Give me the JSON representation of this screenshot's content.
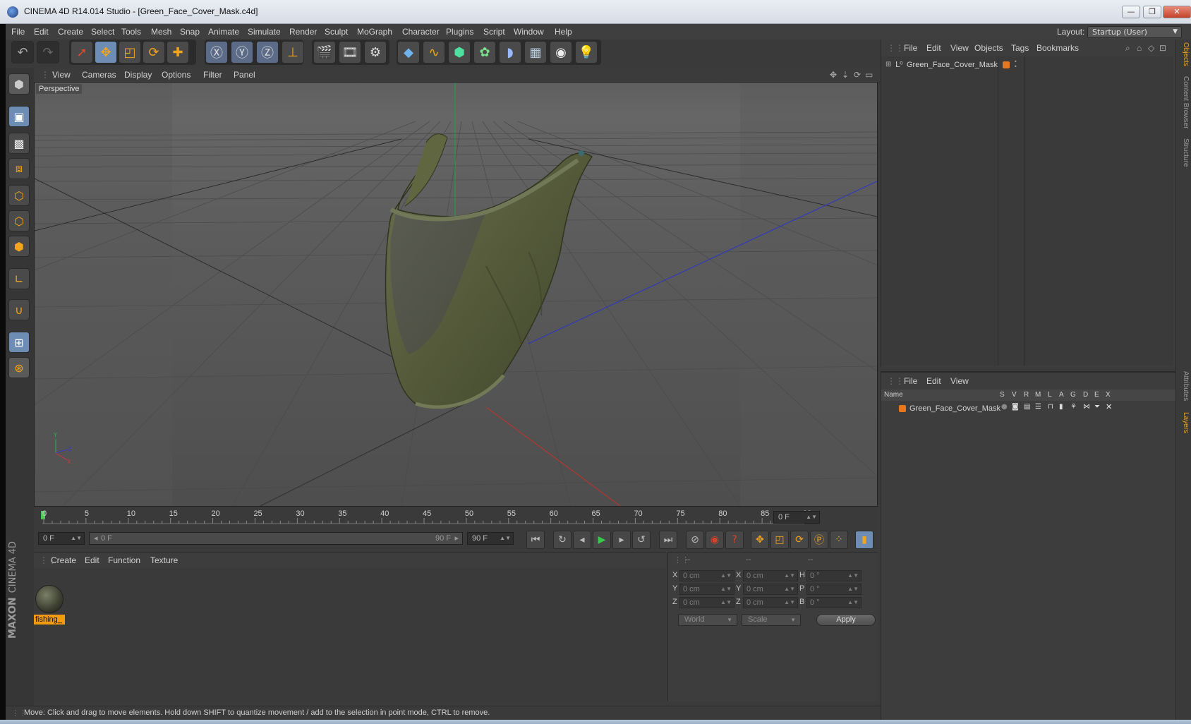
{
  "window": {
    "title": "CINEMA 4D R14.014 Studio - [Green_Face_Cover_Mask.c4d]",
    "min": "—",
    "max": "❐",
    "close": "✕"
  },
  "menubar": {
    "items": [
      "File",
      "Edit",
      "Create",
      "Select",
      "Tools",
      "Mesh",
      "Snap",
      "Animate",
      "Simulate",
      "Render",
      "Sculpt",
      "MoGraph",
      "Character",
      "Plugins",
      "Script",
      "Window",
      "Help"
    ],
    "layout_label": "Layout:",
    "layout_value": "Startup (User)"
  },
  "viewport": {
    "menu": [
      "View",
      "Cameras",
      "Display",
      "Options",
      "Filter",
      "Panel"
    ],
    "label": "Perspective"
  },
  "timeline": {
    "ticks": [
      "0",
      "5",
      "10",
      "15",
      "20",
      "25",
      "30",
      "35",
      "40",
      "45",
      "50",
      "55",
      "60",
      "65",
      "70",
      "75",
      "80",
      "85",
      "90"
    ],
    "current_frame_field": "0 F",
    "start_field": "0 F",
    "range_start": "0 F",
    "range_end": "90 F",
    "end_field": "90 F"
  },
  "material_manager": {
    "menu": [
      "Create",
      "Edit",
      "Function",
      "Texture"
    ],
    "material_name": "fishing_"
  },
  "coordinates": {
    "headers": [
      "--",
      "--",
      "--"
    ],
    "pos_labels": [
      "X",
      "Y",
      "Z"
    ],
    "size_labels": [
      "X",
      "Y",
      "Z"
    ],
    "rot_labels": [
      "H",
      "P",
      "B"
    ],
    "pos_values": [
      "0 cm",
      "0 cm",
      "0 cm"
    ],
    "size_values": [
      "0 cm",
      "0 cm",
      "0 cm"
    ],
    "rot_values": [
      "0 °",
      "0 °",
      "0 °"
    ],
    "world_dropdown": "World",
    "scale_dropdown": "Scale",
    "apply": "Apply"
  },
  "status": {
    "text": "Move: Click and drag to move elements. Hold down SHIFT to quantize movement / add to the selection in point mode, CTRL to remove."
  },
  "object_manager": {
    "menu": [
      "File",
      "Edit",
      "View",
      "Objects",
      "Tags",
      "Bookmarks"
    ],
    "object_name": "Green_Face_Cover_Mask"
  },
  "layer_manager": {
    "menu": [
      "File",
      "Edit",
      "View"
    ],
    "columns": [
      "Name",
      "S",
      "V",
      "R",
      "M",
      "L",
      "A",
      "G",
      "D",
      "E",
      "X"
    ],
    "layer_name": "Green_Face_Cover_Mask"
  },
  "side_tabs": [
    "Objects",
    "Content Browser",
    "Structure",
    "Attributes",
    "Layers"
  ],
  "logo": {
    "brand": "MAXON",
    "product": "CINEMA 4D"
  },
  "colors": {
    "accent": "#f2a41b",
    "active_tool": "#6e8db5",
    "object_tag": "#e7761c",
    "mask_green": "#5a6040"
  }
}
